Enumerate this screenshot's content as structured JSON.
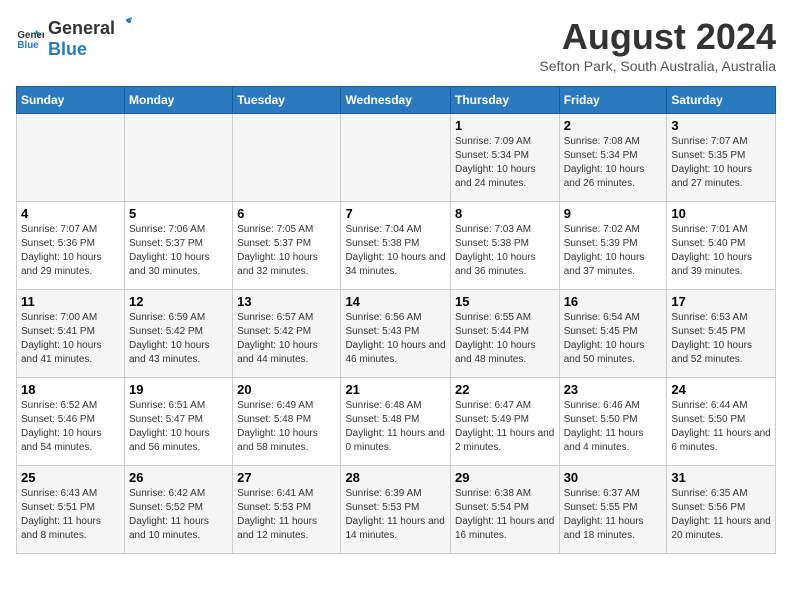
{
  "header": {
    "logo_general": "General",
    "logo_blue": "Blue",
    "month_year": "August 2024",
    "location": "Sefton Park, South Australia, Australia"
  },
  "days_of_week": [
    "Sunday",
    "Monday",
    "Tuesday",
    "Wednesday",
    "Thursday",
    "Friday",
    "Saturday"
  ],
  "weeks": [
    [
      {
        "day": "",
        "sunrise": "",
        "sunset": "",
        "daylight": ""
      },
      {
        "day": "",
        "sunrise": "",
        "sunset": "",
        "daylight": ""
      },
      {
        "day": "",
        "sunrise": "",
        "sunset": "",
        "daylight": ""
      },
      {
        "day": "",
        "sunrise": "",
        "sunset": "",
        "daylight": ""
      },
      {
        "day": "1",
        "sunrise": "Sunrise: 7:09 AM",
        "sunset": "Sunset: 5:34 PM",
        "daylight": "Daylight: 10 hours and 24 minutes."
      },
      {
        "day": "2",
        "sunrise": "Sunrise: 7:08 AM",
        "sunset": "Sunset: 5:34 PM",
        "daylight": "Daylight: 10 hours and 26 minutes."
      },
      {
        "day": "3",
        "sunrise": "Sunrise: 7:07 AM",
        "sunset": "Sunset: 5:35 PM",
        "daylight": "Daylight: 10 hours and 27 minutes."
      }
    ],
    [
      {
        "day": "4",
        "sunrise": "Sunrise: 7:07 AM",
        "sunset": "Sunset: 5:36 PM",
        "daylight": "Daylight: 10 hours and 29 minutes."
      },
      {
        "day": "5",
        "sunrise": "Sunrise: 7:06 AM",
        "sunset": "Sunset: 5:37 PM",
        "daylight": "Daylight: 10 hours and 30 minutes."
      },
      {
        "day": "6",
        "sunrise": "Sunrise: 7:05 AM",
        "sunset": "Sunset: 5:37 PM",
        "daylight": "Daylight: 10 hours and 32 minutes."
      },
      {
        "day": "7",
        "sunrise": "Sunrise: 7:04 AM",
        "sunset": "Sunset: 5:38 PM",
        "daylight": "Daylight: 10 hours and 34 minutes."
      },
      {
        "day": "8",
        "sunrise": "Sunrise: 7:03 AM",
        "sunset": "Sunset: 5:38 PM",
        "daylight": "Daylight: 10 hours and 36 minutes."
      },
      {
        "day": "9",
        "sunrise": "Sunrise: 7:02 AM",
        "sunset": "Sunset: 5:39 PM",
        "daylight": "Daylight: 10 hours and 37 minutes."
      },
      {
        "day": "10",
        "sunrise": "Sunrise: 7:01 AM",
        "sunset": "Sunset: 5:40 PM",
        "daylight": "Daylight: 10 hours and 39 minutes."
      }
    ],
    [
      {
        "day": "11",
        "sunrise": "Sunrise: 7:00 AM",
        "sunset": "Sunset: 5:41 PM",
        "daylight": "Daylight: 10 hours and 41 minutes."
      },
      {
        "day": "12",
        "sunrise": "Sunrise: 6:59 AM",
        "sunset": "Sunset: 5:42 PM",
        "daylight": "Daylight: 10 hours and 43 minutes."
      },
      {
        "day": "13",
        "sunrise": "Sunrise: 6:57 AM",
        "sunset": "Sunset: 5:42 PM",
        "daylight": "Daylight: 10 hours and 44 minutes."
      },
      {
        "day": "14",
        "sunrise": "Sunrise: 6:56 AM",
        "sunset": "Sunset: 5:43 PM",
        "daylight": "Daylight: 10 hours and 46 minutes."
      },
      {
        "day": "15",
        "sunrise": "Sunrise: 6:55 AM",
        "sunset": "Sunset: 5:44 PM",
        "daylight": "Daylight: 10 hours and 48 minutes."
      },
      {
        "day": "16",
        "sunrise": "Sunrise: 6:54 AM",
        "sunset": "Sunset: 5:45 PM",
        "daylight": "Daylight: 10 hours and 50 minutes."
      },
      {
        "day": "17",
        "sunrise": "Sunrise: 6:53 AM",
        "sunset": "Sunset: 5:45 PM",
        "daylight": "Daylight: 10 hours and 52 minutes."
      }
    ],
    [
      {
        "day": "18",
        "sunrise": "Sunrise: 6:52 AM",
        "sunset": "Sunset: 5:46 PM",
        "daylight": "Daylight: 10 hours and 54 minutes."
      },
      {
        "day": "19",
        "sunrise": "Sunrise: 6:51 AM",
        "sunset": "Sunset: 5:47 PM",
        "daylight": "Daylight: 10 hours and 56 minutes."
      },
      {
        "day": "20",
        "sunrise": "Sunrise: 6:49 AM",
        "sunset": "Sunset: 5:48 PM",
        "daylight": "Daylight: 10 hours and 58 minutes."
      },
      {
        "day": "21",
        "sunrise": "Sunrise: 6:48 AM",
        "sunset": "Sunset: 5:48 PM",
        "daylight": "Daylight: 11 hours and 0 minutes."
      },
      {
        "day": "22",
        "sunrise": "Sunrise: 6:47 AM",
        "sunset": "Sunset: 5:49 PM",
        "daylight": "Daylight: 11 hours and 2 minutes."
      },
      {
        "day": "23",
        "sunrise": "Sunrise: 6:46 AM",
        "sunset": "Sunset: 5:50 PM",
        "daylight": "Daylight: 11 hours and 4 minutes."
      },
      {
        "day": "24",
        "sunrise": "Sunrise: 6:44 AM",
        "sunset": "Sunset: 5:50 PM",
        "daylight": "Daylight: 11 hours and 6 minutes."
      }
    ],
    [
      {
        "day": "25",
        "sunrise": "Sunrise: 6:43 AM",
        "sunset": "Sunset: 5:51 PM",
        "daylight": "Daylight: 11 hours and 8 minutes."
      },
      {
        "day": "26",
        "sunrise": "Sunrise: 6:42 AM",
        "sunset": "Sunset: 5:52 PM",
        "daylight": "Daylight: 11 hours and 10 minutes."
      },
      {
        "day": "27",
        "sunrise": "Sunrise: 6:41 AM",
        "sunset": "Sunset: 5:53 PM",
        "daylight": "Daylight: 11 hours and 12 minutes."
      },
      {
        "day": "28",
        "sunrise": "Sunrise: 6:39 AM",
        "sunset": "Sunset: 5:53 PM",
        "daylight": "Daylight: 11 hours and 14 minutes."
      },
      {
        "day": "29",
        "sunrise": "Sunrise: 6:38 AM",
        "sunset": "Sunset: 5:54 PM",
        "daylight": "Daylight: 11 hours and 16 minutes."
      },
      {
        "day": "30",
        "sunrise": "Sunrise: 6:37 AM",
        "sunset": "Sunset: 5:55 PM",
        "daylight": "Daylight: 11 hours and 18 minutes."
      },
      {
        "day": "31",
        "sunrise": "Sunrise: 6:35 AM",
        "sunset": "Sunset: 5:56 PM",
        "daylight": "Daylight: 11 hours and 20 minutes."
      }
    ]
  ]
}
